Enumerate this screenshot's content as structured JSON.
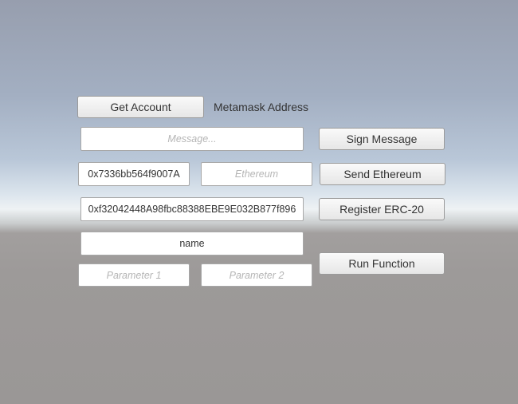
{
  "buttons": {
    "get_account": "Get Account",
    "sign_message": "Sign Message",
    "send_ethereum": "Send Ethereum",
    "register_erc20": "Register ERC-20",
    "run_function": "Run Function"
  },
  "labels": {
    "metamask_address": "Metamask Address"
  },
  "fields": {
    "message_placeholder": "Message...",
    "to_address_value": "0x7336bb564f9007A",
    "ethereum_placeholder": "Ethereum",
    "contract_address_value": "0xf32042448A98fbc88388EBE9E032B877f896",
    "function_name_value": "name",
    "parameter1_placeholder": "Parameter 1",
    "parameter2_placeholder": "Parameter 2"
  }
}
